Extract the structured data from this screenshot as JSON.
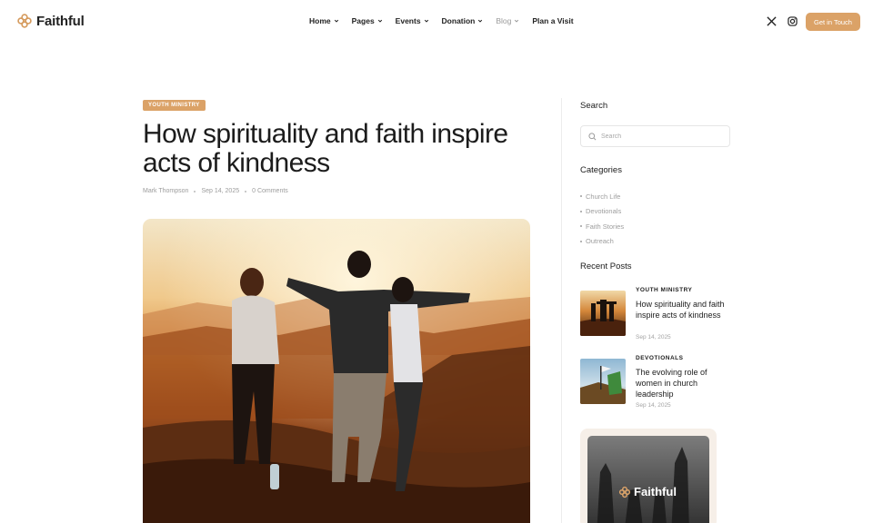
{
  "header": {
    "logo_text": "Faithful",
    "nav": [
      {
        "label": "Home",
        "has_dropdown": true
      },
      {
        "label": "Pages",
        "has_dropdown": true
      },
      {
        "label": "Events",
        "has_dropdown": true
      },
      {
        "label": "Donation",
        "has_dropdown": true
      },
      {
        "label": "Blog",
        "has_dropdown": true,
        "muted": true
      },
      {
        "label": "Plan a Visit",
        "has_dropdown": false
      }
    ],
    "social_icons": [
      "x-icon",
      "instagram-icon"
    ],
    "cta_label": "Get in Touch"
  },
  "article": {
    "category": "YOUTH MINISTRY",
    "title": "How spirituality and faith inspire acts of kindness",
    "author": "Mark Thompson",
    "date": "Sep 14, 2025",
    "comments": "0 Comments"
  },
  "sidebar": {
    "search_heading": "Search",
    "search_placeholder": "Search",
    "categories_heading": "Categories",
    "categories": [
      "Church Life",
      "Devotionals",
      "Faith Stories",
      "Outreach"
    ],
    "recent_heading": "Recent Posts",
    "recent_posts": [
      {
        "category": "YOUTH MINISTRY",
        "title": "How spirituality and faith inspire acts of kindness",
        "date": "Sep 14, 2025"
      },
      {
        "category": "DEVOTIONALS",
        "title": "The evolving role of women in church leadership",
        "date": "Sep 14, 2025"
      }
    ],
    "promo_logo_text": "Faithful"
  },
  "colors": {
    "accent": "#dba267",
    "text": "#1b1b1b",
    "muted": "#9d9d9d"
  }
}
